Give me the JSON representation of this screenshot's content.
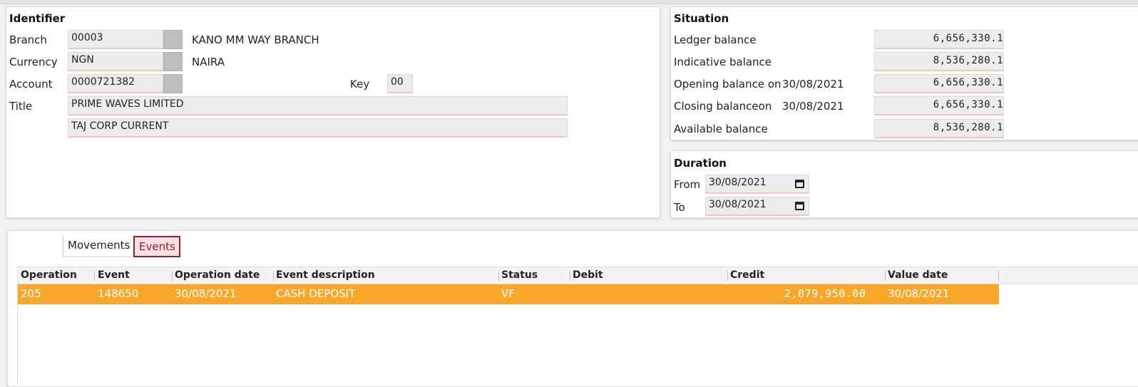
{
  "identifier": {
    "title": "Identifier",
    "branch": {
      "label": "Branch",
      "code": "00003",
      "name": "KANO MM WAY BRANCH"
    },
    "currency": {
      "label": "Currency",
      "code": "NGN",
      "name": "NAIRA"
    },
    "account": {
      "label": "Account",
      "number": "0000721382",
      "key_label": "Key",
      "key": "00"
    },
    "title_field": {
      "label": "Title",
      "line1": "PRIME WAVES LIMITED",
      "line2": "TAJ CORP CURRENT"
    }
  },
  "situation": {
    "title": "Situation",
    "ledger": {
      "label": "Ledger balance",
      "value": "6,656,330.1"
    },
    "indicative": {
      "label": "Indicative balance",
      "value": "8,536,280.1"
    },
    "opening": {
      "label": "Opening balance on",
      "date": "30/08/2021",
      "value": "6,656,330.1"
    },
    "closing": {
      "label": "Closing balanceon",
      "date": "30/08/2021",
      "value": "6,656,330.1"
    },
    "available": {
      "label": "Available balance",
      "value": "8,536,280.1"
    }
  },
  "duration": {
    "title": "Duration",
    "from_label": "From",
    "from": "30/08/2021",
    "to_label": "To",
    "to": "30/08/2021"
  },
  "tabs": {
    "movements": "Movements",
    "events": "Events",
    "active": "Events"
  },
  "table": {
    "columns": [
      "Operation",
      "Event",
      "Operation date",
      "Event description",
      "Status",
      "Debit",
      "Credit",
      "Value date"
    ],
    "rows": [
      {
        "operation": "205",
        "event": "148650",
        "operation_date": "30/08/2021",
        "event_description": "CASH DEPOSIT",
        "status": "VF",
        "debit": "",
        "credit": "2,079,950.00",
        "value_date": "30/08/2021"
      }
    ]
  },
  "colors": {
    "selected_row": "#f9a72a",
    "active_tab_border": "#a01c2c",
    "field_underline": "#f4c4c4"
  }
}
